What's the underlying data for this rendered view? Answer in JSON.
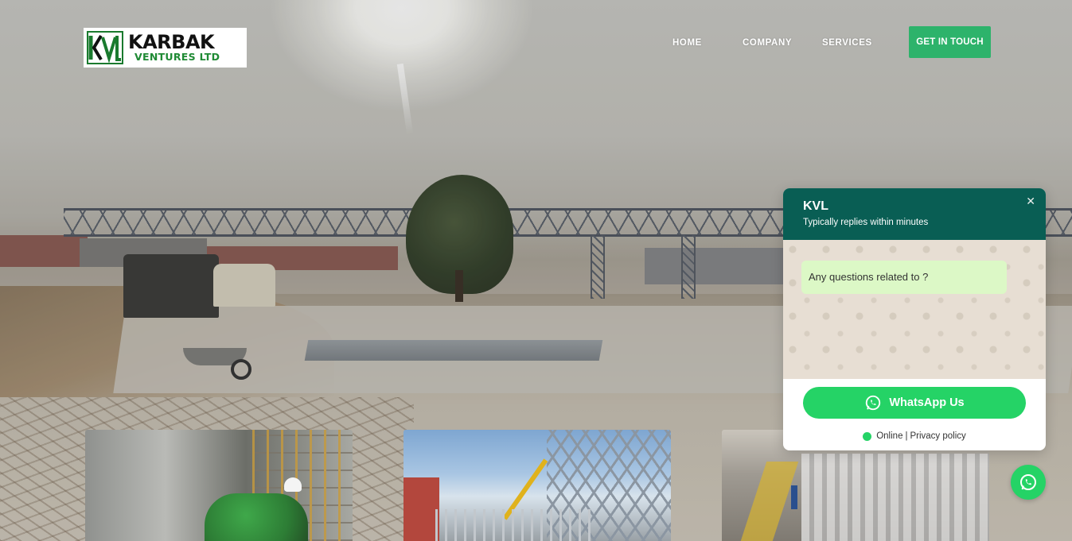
{
  "logo": {
    "name": "KARBAK",
    "subtitle": "VENTURES LTD"
  },
  "nav": {
    "items": [
      {
        "label": "HOME"
      },
      {
        "label": "COMPANY"
      },
      {
        "label": "SERVICES"
      }
    ],
    "cta_label": "GET IN TOUCH"
  },
  "colors": {
    "brand_green": "#2db36b",
    "whatsapp_header": "#095e54",
    "whatsapp_green": "#25d366",
    "bubble": "#dcf8c6"
  },
  "whatsapp": {
    "title": "KVL",
    "subtitle": "Typically replies within minutes",
    "close_icon": "close-icon",
    "message": "Any questions related to ?",
    "button_label": "WhatsApp Us",
    "status": "Online",
    "separator": "|",
    "privacy_label": "Privacy policy"
  }
}
